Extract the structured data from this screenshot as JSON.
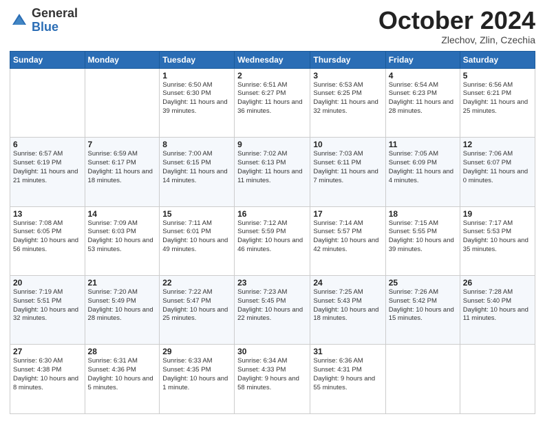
{
  "header": {
    "logo_general": "General",
    "logo_blue": "Blue",
    "title": "October 2024",
    "location": "Zlechov, Zlin, Czechia"
  },
  "days_of_week": [
    "Sunday",
    "Monday",
    "Tuesday",
    "Wednesday",
    "Thursday",
    "Friday",
    "Saturday"
  ],
  "weeks": [
    [
      {
        "day": "",
        "info": ""
      },
      {
        "day": "",
        "info": ""
      },
      {
        "day": "1",
        "info": "Sunrise: 6:50 AM\nSunset: 6:30 PM\nDaylight: 11 hours and 39 minutes."
      },
      {
        "day": "2",
        "info": "Sunrise: 6:51 AM\nSunset: 6:27 PM\nDaylight: 11 hours and 36 minutes."
      },
      {
        "day": "3",
        "info": "Sunrise: 6:53 AM\nSunset: 6:25 PM\nDaylight: 11 hours and 32 minutes."
      },
      {
        "day": "4",
        "info": "Sunrise: 6:54 AM\nSunset: 6:23 PM\nDaylight: 11 hours and 28 minutes."
      },
      {
        "day": "5",
        "info": "Sunrise: 6:56 AM\nSunset: 6:21 PM\nDaylight: 11 hours and 25 minutes."
      }
    ],
    [
      {
        "day": "6",
        "info": "Sunrise: 6:57 AM\nSunset: 6:19 PM\nDaylight: 11 hours and 21 minutes."
      },
      {
        "day": "7",
        "info": "Sunrise: 6:59 AM\nSunset: 6:17 PM\nDaylight: 11 hours and 18 minutes."
      },
      {
        "day": "8",
        "info": "Sunrise: 7:00 AM\nSunset: 6:15 PM\nDaylight: 11 hours and 14 minutes."
      },
      {
        "day": "9",
        "info": "Sunrise: 7:02 AM\nSunset: 6:13 PM\nDaylight: 11 hours and 11 minutes."
      },
      {
        "day": "10",
        "info": "Sunrise: 7:03 AM\nSunset: 6:11 PM\nDaylight: 11 hours and 7 minutes."
      },
      {
        "day": "11",
        "info": "Sunrise: 7:05 AM\nSunset: 6:09 PM\nDaylight: 11 hours and 4 minutes."
      },
      {
        "day": "12",
        "info": "Sunrise: 7:06 AM\nSunset: 6:07 PM\nDaylight: 11 hours and 0 minutes."
      }
    ],
    [
      {
        "day": "13",
        "info": "Sunrise: 7:08 AM\nSunset: 6:05 PM\nDaylight: 10 hours and 56 minutes."
      },
      {
        "day": "14",
        "info": "Sunrise: 7:09 AM\nSunset: 6:03 PM\nDaylight: 10 hours and 53 minutes."
      },
      {
        "day": "15",
        "info": "Sunrise: 7:11 AM\nSunset: 6:01 PM\nDaylight: 10 hours and 49 minutes."
      },
      {
        "day": "16",
        "info": "Sunrise: 7:12 AM\nSunset: 5:59 PM\nDaylight: 10 hours and 46 minutes."
      },
      {
        "day": "17",
        "info": "Sunrise: 7:14 AM\nSunset: 5:57 PM\nDaylight: 10 hours and 42 minutes."
      },
      {
        "day": "18",
        "info": "Sunrise: 7:15 AM\nSunset: 5:55 PM\nDaylight: 10 hours and 39 minutes."
      },
      {
        "day": "19",
        "info": "Sunrise: 7:17 AM\nSunset: 5:53 PM\nDaylight: 10 hours and 35 minutes."
      }
    ],
    [
      {
        "day": "20",
        "info": "Sunrise: 7:19 AM\nSunset: 5:51 PM\nDaylight: 10 hours and 32 minutes."
      },
      {
        "day": "21",
        "info": "Sunrise: 7:20 AM\nSunset: 5:49 PM\nDaylight: 10 hours and 28 minutes."
      },
      {
        "day": "22",
        "info": "Sunrise: 7:22 AM\nSunset: 5:47 PM\nDaylight: 10 hours and 25 minutes."
      },
      {
        "day": "23",
        "info": "Sunrise: 7:23 AM\nSunset: 5:45 PM\nDaylight: 10 hours and 22 minutes."
      },
      {
        "day": "24",
        "info": "Sunrise: 7:25 AM\nSunset: 5:43 PM\nDaylight: 10 hours and 18 minutes."
      },
      {
        "day": "25",
        "info": "Sunrise: 7:26 AM\nSunset: 5:42 PM\nDaylight: 10 hours and 15 minutes."
      },
      {
        "day": "26",
        "info": "Sunrise: 7:28 AM\nSunset: 5:40 PM\nDaylight: 10 hours and 11 minutes."
      }
    ],
    [
      {
        "day": "27",
        "info": "Sunrise: 6:30 AM\nSunset: 4:38 PM\nDaylight: 10 hours and 8 minutes."
      },
      {
        "day": "28",
        "info": "Sunrise: 6:31 AM\nSunset: 4:36 PM\nDaylight: 10 hours and 5 minutes."
      },
      {
        "day": "29",
        "info": "Sunrise: 6:33 AM\nSunset: 4:35 PM\nDaylight: 10 hours and 1 minute."
      },
      {
        "day": "30",
        "info": "Sunrise: 6:34 AM\nSunset: 4:33 PM\nDaylight: 9 hours and 58 minutes."
      },
      {
        "day": "31",
        "info": "Sunrise: 6:36 AM\nSunset: 4:31 PM\nDaylight: 9 hours and 55 minutes."
      },
      {
        "day": "",
        "info": ""
      },
      {
        "day": "",
        "info": ""
      }
    ]
  ]
}
